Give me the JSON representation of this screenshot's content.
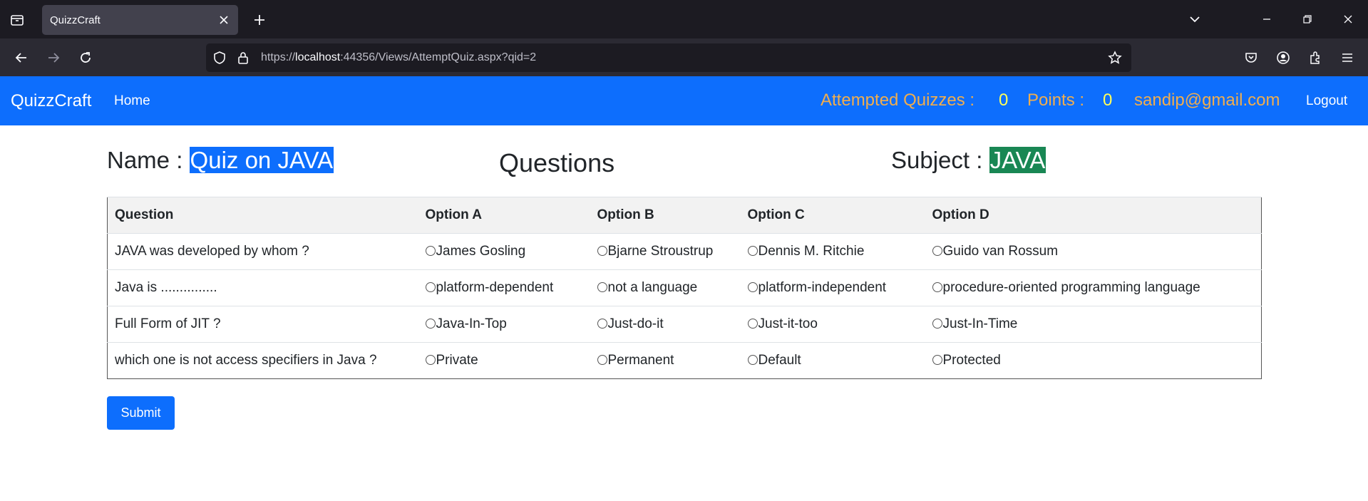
{
  "browser": {
    "tab_title": "QuizzCraft",
    "url_prefix": "https://",
    "url_host": "localhost",
    "url_rest": ":44356/Views/AttemptQuiz.aspx?qid=2"
  },
  "navbar": {
    "brand": "QuizzCraft",
    "home": "Home",
    "attempted_label": "Attempted Quizzes :",
    "attempted_value": "0",
    "points_label": "Points :",
    "points_value": "0",
    "email": "sandip@gmail.com",
    "logout": "Logout"
  },
  "header": {
    "name_label": "Name :",
    "name_value": "Quiz on JAVA",
    "title": "Questions",
    "subject_label": "Subject :",
    "subject_value": "JAVA"
  },
  "table": {
    "headers": [
      "Question",
      "Option A",
      "Option B",
      "Option C",
      "Option D"
    ],
    "rows": [
      {
        "question": "JAVA was developed by whom ?",
        "a": "James Gosling",
        "b": "Bjarne Stroustrup",
        "c": "Dennis M. Ritchie",
        "d": "Guido van Rossum"
      },
      {
        "question": "Java is ...............",
        "a": "platform-dependent",
        "b": "not a language",
        "c": "platform-independent",
        "d": "procedure-oriented programming language"
      },
      {
        "question": "Full Form of JIT ?",
        "a": "Java-In-Top",
        "b": "Just-do-it",
        "c": "Just-it-too",
        "d": "Just-In-Time"
      },
      {
        "question": "which one is not access specifiers in Java ?",
        "a": "Private",
        "b": "Permanent",
        "c": "Default",
        "d": "Protected"
      }
    ]
  },
  "submit_label": "Submit",
  "colors": {
    "navbar": "#0d6efd",
    "stat_label": "#f0ad4e",
    "stat_value": "#ffff5a",
    "subject_bg": "#198754"
  }
}
